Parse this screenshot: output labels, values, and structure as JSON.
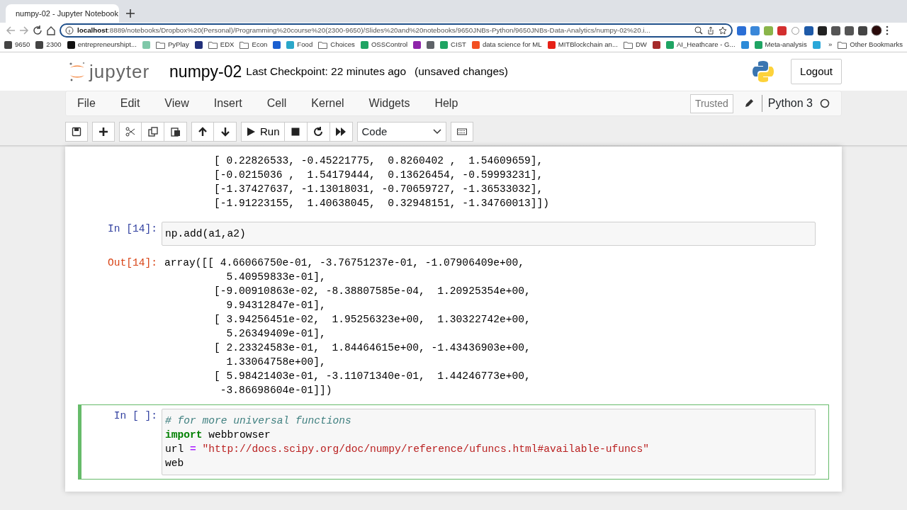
{
  "browser": {
    "tab": {
      "title": "numpy-02 - Jupyter Notebook"
    },
    "address": "**localhost**:8889/notebooks/Dropbox%20(Personal)/Programming%20course%20(2300-9650)/Slides%20and%20notebooks/9650JNBs-Python/9650JNBs-Data-Analytics/numpy-02%20.i...",
    "bookmarks": [
      {
        "label": "9650",
        "kind": "site",
        "color": "#444444"
      },
      {
        "label": "2300",
        "kind": "site",
        "color": "#444444"
      },
      {
        "label": "entrepreneurshipt...",
        "kind": "site",
        "color": "#111111"
      },
      {
        "kind": "site",
        "color": "#7fc8a9"
      },
      {
        "label": "PyPlay",
        "kind": "folder"
      },
      {
        "kind": "site",
        "color": "#22307a"
      },
      {
        "label": "EDX",
        "kind": "folder"
      },
      {
        "label": "Econ",
        "kind": "folder"
      },
      {
        "kind": "site",
        "color": "#1a5fd0"
      },
      {
        "label": "Food",
        "kind": "site",
        "color": "#2aa7c9"
      },
      {
        "label": "Choices",
        "kind": "folder"
      },
      {
        "label": "OSSControl",
        "kind": "site",
        "color": "#1fa463"
      },
      {
        "kind": "site",
        "color": "#8e24aa"
      },
      {
        "kind": "site",
        "color": "#5f6368"
      },
      {
        "label": "CIST",
        "kind": "site",
        "color": "#1fa463"
      },
      {
        "label": "data science for ML",
        "kind": "site",
        "color": "#f25022"
      },
      {
        "label": "MITBlockchain an...",
        "kind": "site",
        "color": "#e62117"
      },
      {
        "label": "DW",
        "kind": "folder"
      },
      {
        "kind": "site",
        "color": "#a52a2a"
      },
      {
        "label": "AI_Heathcare - G...",
        "kind": "site",
        "color": "#1fa463"
      },
      {
        "kind": "site",
        "color": "#2b8ad8"
      },
      {
        "label": "Meta-analysis",
        "kind": "site",
        "color": "#1fa463"
      },
      {
        "kind": "site",
        "color": "#2aa7d9"
      }
    ],
    "more": "»",
    "other": "Other Bookmarks"
  },
  "header": {
    "logo_text": "jupyter",
    "notebook_name": "numpy-02",
    "checkpoint": "Last Checkpoint: 22 minutes ago",
    "status": "(unsaved changes)",
    "logout": "Logout"
  },
  "menu": {
    "items": [
      "File",
      "Edit",
      "View",
      "Insert",
      "Cell",
      "Kernel",
      "Widgets",
      "Help"
    ],
    "trusted": "Trusted",
    "kernel": "Python 3",
    "kernel_busy": false
  },
  "toolbar": {
    "run": "Run",
    "cell_type": "Code"
  },
  "cells": [
    {
      "kind": "output",
      "lines": [
        "        [ 0.22826533, -0.45221775,  0.8260402 ,  1.54609659],",
        "        [-0.0215036 ,  1.54179444,  0.13626454, -0.59993231],",
        "        [-1.37427637, -1.13018031, -0.70659727, -1.36533032],",
        "        [-1.91223155,  1.40638045,  0.32948151, -1.34760013]])"
      ]
    },
    {
      "kind": "input",
      "prompt": "In [14]:",
      "selected": false,
      "lines": [
        [
          {
            "text": "np.add(a1,a2)",
            "kind": "plain"
          }
        ]
      ]
    },
    {
      "kind": "output",
      "prompt": "Out[14]:",
      "lines": [
        "array([[ 4.66066750e-01, -3.76751237e-01, -1.07906409e+00,",
        "          5.40959833e-01],",
        "        [-9.00910863e-02, -8.38807585e-04,  1.20925354e+00,",
        "          9.94312847e-01],",
        "        [ 3.94256451e-02,  1.95256323e+00,  1.30322742e+00,",
        "          5.26349409e-01],",
        "        [ 2.23324583e-01,  1.84464615e+00, -1.43436903e+00,",
        "          1.33064758e+00],",
        "        [ 5.98421403e-01, -3.11071340e-01,  1.44246773e+00,",
        "         -3.86698604e-01]])"
      ]
    },
    {
      "kind": "input",
      "prompt": "In [ ]:",
      "selected": true,
      "lines": [
        [
          {
            "text": "# for more universal functions",
            "kind": "comment"
          }
        ],
        [
          {
            "text": "import",
            "kind": "keyword"
          },
          {
            "text": " webbrowser",
            "kind": "plain"
          }
        ],
        [
          {
            "text": "url ",
            "kind": "plain"
          },
          {
            "text": "= ",
            "kind": "operator"
          },
          {
            "text": "\"http://docs.scipy.org/doc/numpy/reference/ufuncs.html#available-ufuncs\"",
            "kind": "string"
          }
        ],
        [
          {
            "text": "web",
            "kind": "plain"
          }
        ]
      ]
    }
  ]
}
